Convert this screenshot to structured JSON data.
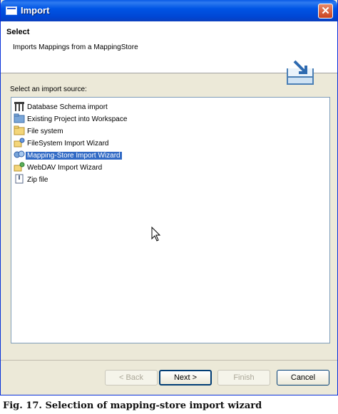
{
  "window": {
    "title": "Import",
    "close_label": "✕"
  },
  "header": {
    "title": "Select",
    "description": "Imports Mappings from a MappingStore",
    "icon": "import-wizard-icon"
  },
  "prompt": "Select an import source:",
  "sources": [
    {
      "label": "Database Schema import",
      "icon": "database-schema-icon"
    },
    {
      "label": "Existing Project into Workspace",
      "icon": "project-folder-icon"
    },
    {
      "label": "File system",
      "icon": "folder-icon"
    },
    {
      "label": "FileSystem Import Wizard",
      "icon": "wizard-icon"
    },
    {
      "label": "Mapping-Store Import Wizard",
      "icon": "mapping-wizard-icon",
      "selected": true
    },
    {
      "label": "WebDAV Import Wizard",
      "icon": "webdav-wizard-icon"
    },
    {
      "label": "Zip file",
      "icon": "zip-file-icon"
    }
  ],
  "buttons": {
    "back": "< Back",
    "next": "Next >",
    "finish": "Finish",
    "cancel": "Cancel"
  },
  "caption": "Fig. 17.   Selection of mapping-store import wizard",
  "colors": {
    "selection": "#316ac5",
    "titlebar": "#0055e5",
    "dialog_bg": "#ece9d8"
  }
}
